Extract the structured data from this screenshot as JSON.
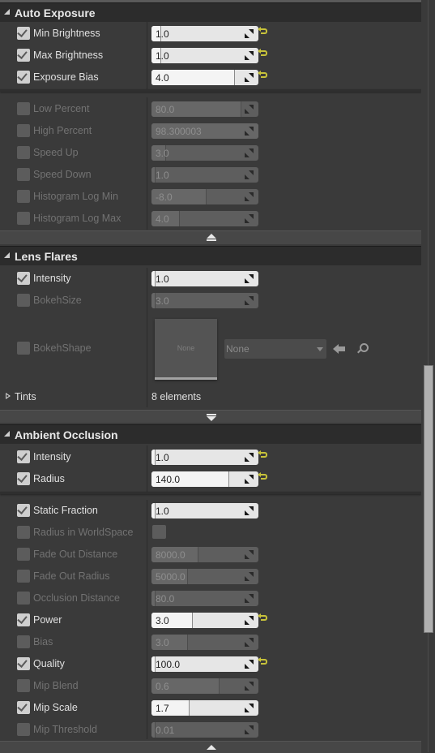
{
  "sections": {
    "auto_exposure": {
      "title": "Auto Exposure",
      "rows": [
        {
          "label": "Min Brightness",
          "value": "1.0",
          "checked": true,
          "fill": 0.05,
          "reset": true
        },
        {
          "label": "Max Brightness",
          "value": "1.0",
          "checked": true,
          "fill": 0.05,
          "reset": true
        },
        {
          "label": "Exposure Bias",
          "value": "4.0",
          "checked": true,
          "fill": 0.74,
          "reset": true
        }
      ],
      "advanced_rows": [
        {
          "label": "Low Percent",
          "value": "80.0",
          "checked": false,
          "fill": 0.8
        },
        {
          "label": "High Percent",
          "value": "98.300003",
          "checked": false,
          "fill": 0.98
        },
        {
          "label": "Speed Up",
          "value": "3.0",
          "checked": false,
          "fill": 0.1
        },
        {
          "label": "Speed Down",
          "value": "1.0",
          "checked": false,
          "fill": 0.0
        },
        {
          "label": "Histogram Log Min",
          "value": "-8.0",
          "checked": false,
          "fill": 0.48
        },
        {
          "label": "Histogram Log Max",
          "value": "4.0",
          "checked": false,
          "fill": 0.23
        }
      ]
    },
    "lens_flares": {
      "title": "Lens Flares",
      "rows": [
        {
          "label": "Intensity",
          "value": "1.0",
          "checked": true,
          "fill": 0.0
        },
        {
          "label": "BokehSize",
          "value": "3.0",
          "checked": false,
          "fill": 0.0
        }
      ],
      "bokeh_shape": {
        "label": "BokehShape",
        "checked": false,
        "thumbnail_label": "None",
        "combo_value": "None",
        "use_icon": "arrow-left-icon",
        "browse_icon": "search-icon"
      },
      "tints": {
        "label": "Tints",
        "value": "8 elements"
      }
    },
    "ambient_occlusion": {
      "title": "Ambient Occlusion",
      "rows": [
        {
          "label": "Intensity",
          "value": "1.0",
          "checked": true,
          "fill": 0.0,
          "reset": true
        },
        {
          "label": "Radius",
          "value": "140.0",
          "checked": true,
          "fill": 0.69,
          "reset": true
        }
      ],
      "advanced_rows": [
        {
          "label": "Static Fraction",
          "value": "1.0",
          "checked": true,
          "fill": 0.0,
          "type": "field"
        },
        {
          "label": "Radius in WorldSpace",
          "checked": false,
          "type": "checkbox",
          "field_checked": false
        },
        {
          "label": "Fade Out Distance",
          "value": "8000.0",
          "checked": false,
          "fill": 0.4,
          "type": "field"
        },
        {
          "label": "Fade Out Radius",
          "value": "5000.0",
          "checked": false,
          "fill": 0.3,
          "type": "field"
        },
        {
          "label": "Occlusion Distance",
          "value": "80.0",
          "checked": false,
          "fill": 0.0,
          "type": "field"
        },
        {
          "label": "Power",
          "value": "3.0",
          "checked": true,
          "fill": 0.35,
          "reset": true,
          "type": "field"
        },
        {
          "label": "Bias",
          "value": "3.0",
          "checked": false,
          "fill": 0.3,
          "type": "field"
        },
        {
          "label": "Quality",
          "value": "100.0",
          "checked": true,
          "fill": 0.0,
          "reset": true,
          "type": "field"
        },
        {
          "label": "Mip Blend",
          "value": "0.6",
          "checked": false,
          "fill": 0.6,
          "type": "field"
        },
        {
          "label": "Mip Scale",
          "value": "1.7",
          "checked": true,
          "fill": 0.32,
          "type": "field"
        },
        {
          "label": "Mip Threshold",
          "value": "0.01",
          "checked": false,
          "fill": 0.0,
          "type": "field"
        }
      ]
    }
  },
  "colors": {
    "reset_arrow": "#c7c23a",
    "panel_bg": "#3a3a3a",
    "header_bg": "#2c2c2c"
  }
}
